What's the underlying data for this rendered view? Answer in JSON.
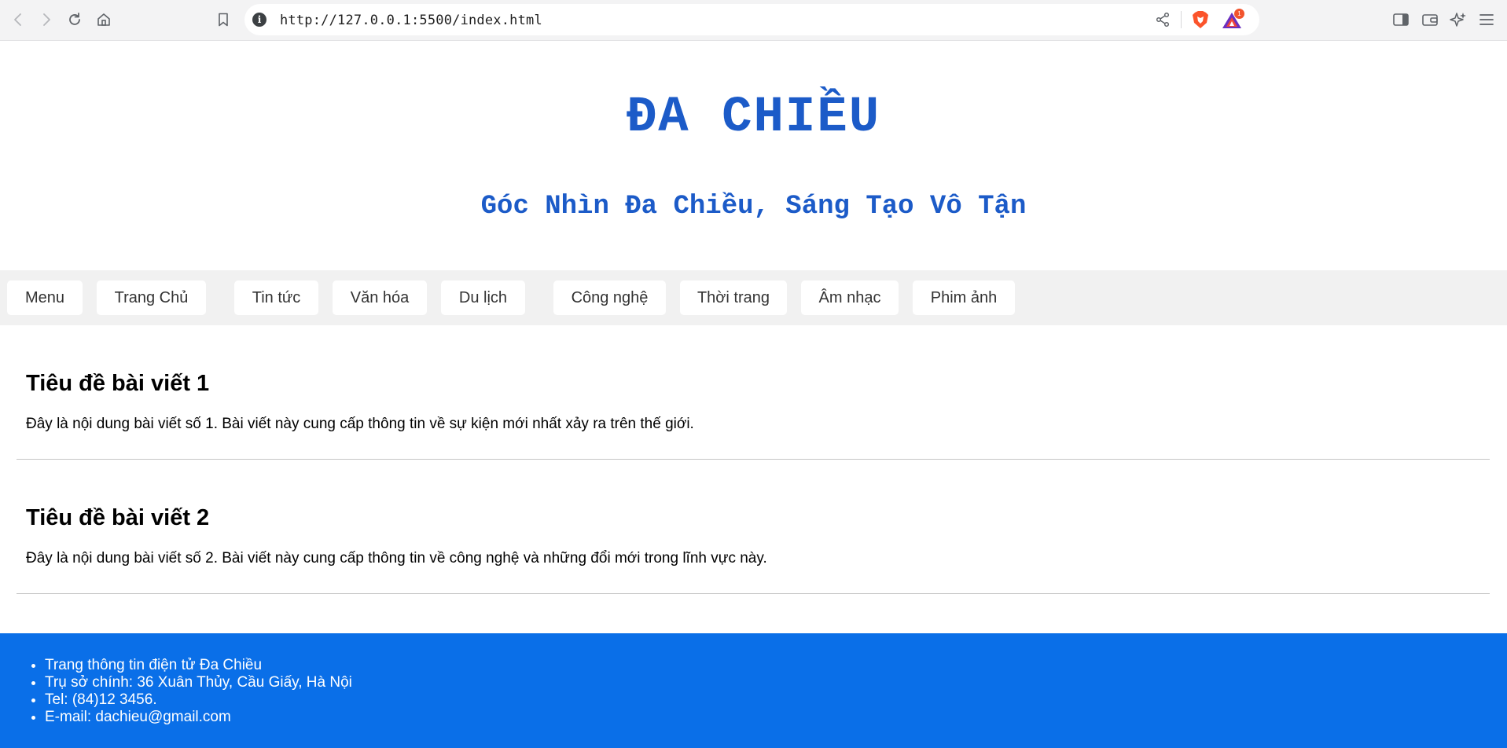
{
  "browser": {
    "url": "http://127.0.0.1:5500/index.html",
    "rewards_badge": "1"
  },
  "header": {
    "title": "ĐA CHIỀU",
    "tagline": "Góc Nhìn Đa Chiều, Sáng Tạo Vô Tận"
  },
  "nav": {
    "items": [
      {
        "label": "Menu"
      },
      {
        "label": "Trang Chủ"
      },
      {
        "label": "Tin tức"
      },
      {
        "label": "Văn hóa"
      },
      {
        "label": "Du lịch"
      },
      {
        "label": "Công nghệ"
      },
      {
        "label": "Thời trang"
      },
      {
        "label": "Âm nhạc"
      },
      {
        "label": "Phim ảnh"
      }
    ]
  },
  "articles": [
    {
      "title": "Tiêu đề bài viết 1",
      "body": "Đây là nội dung bài viết số 1. Bài viết này cung cấp thông tin về sự kiện mới nhất xảy ra trên thế giới."
    },
    {
      "title": "Tiêu đề bài viết 2",
      "body": "Đây là nội dung bài viết số 2. Bài viết này cung cấp thông tin về công nghệ và những đổi mới trong lĩnh vực này."
    }
  ],
  "footer": {
    "items": [
      "Trang thông tin điện tử Đa Chiều",
      "Trụ sở chính: 36 Xuân Thủy, Cầu Giấy, Hà Nội",
      "Tel: (84)12 3456.",
      "E-mail: dachieu@gmail.com"
    ]
  },
  "colors": {
    "brand_blue": "#1c5bc8",
    "footer_blue": "#0a6fe8",
    "nav_bg": "#f1f1f1"
  }
}
